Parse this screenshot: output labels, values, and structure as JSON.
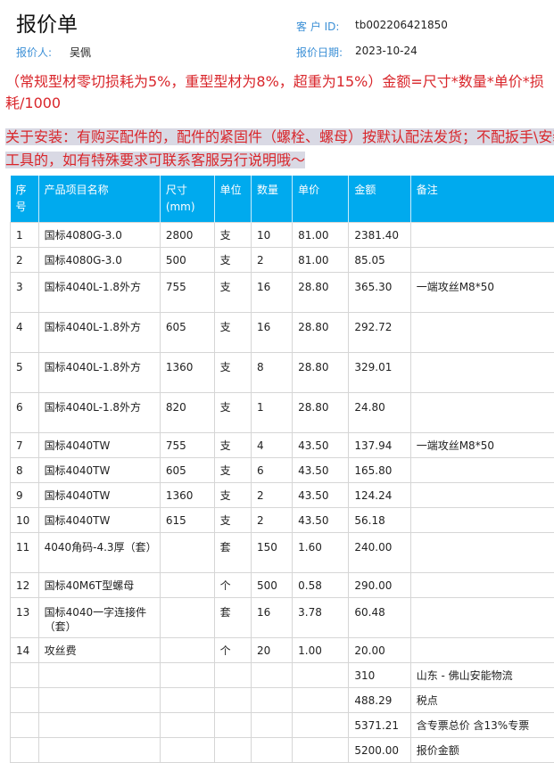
{
  "header": {
    "title": "报价单",
    "customer_id_label": "客 户 ID:",
    "customer_id": "tb002206421850",
    "quoter_label": "报价人:",
    "quoter": "吴佩",
    "date_label": "报价日期:",
    "date": "2023-10-24"
  },
  "notes": {
    "formula": "（常规型材零切损耗为5%，重型型材为8%，超重为15%）金额=尺寸*数量*单价*损耗/1000",
    "install": "关于安装：有购买配件的，配件的紧固件（螺栓、螺母）按默认配法发货；不配扳手\\安装工具的，如有特殊要求可联系客服另行说明哦～"
  },
  "table": {
    "headers": [
      "序号",
      "产品项目名称",
      "尺寸(mm)",
      "单位",
      "数量",
      "单价",
      "金额",
      "备注"
    ],
    "rows": [
      [
        "1",
        "国标4080G-3.0",
        "2800",
        "支",
        "10",
        "81.00",
        "2381.40",
        ""
      ],
      [
        "2",
        "国标4080G-3.0",
        "500",
        "支",
        "2",
        "81.00",
        "85.05",
        ""
      ],
      [
        "3",
        "国标4040L-1.8外方",
        "755",
        "支",
        "16",
        "28.80",
        "365.30",
        "一端攻丝M8*50"
      ],
      [
        "4",
        "国标4040L-1.8外方",
        "605",
        "支",
        "16",
        "28.80",
        "292.72",
        ""
      ],
      [
        "5",
        "国标4040L-1.8外方",
        "1360",
        "支",
        "8",
        "28.80",
        "329.01",
        ""
      ],
      [
        "6",
        "国标4040L-1.8外方",
        "820",
        "支",
        "1",
        "28.80",
        "24.80",
        ""
      ],
      [
        "7",
        "国标4040TW",
        "755",
        "支",
        "4",
        "43.50",
        "137.94",
        "一端攻丝M8*50"
      ],
      [
        "8",
        "国标4040TW",
        "605",
        "支",
        "6",
        "43.50",
        "165.80",
        ""
      ],
      [
        "9",
        "国标4040TW",
        "1360",
        "支",
        "2",
        "43.50",
        "124.24",
        ""
      ],
      [
        "10",
        "国标4040TW",
        "615",
        "支",
        "2",
        "43.50",
        "56.18",
        ""
      ],
      [
        "11",
        "4040角码-4.3厚（套）",
        "",
        "套",
        "150",
        "1.60",
        "240.00",
        ""
      ],
      [
        "12",
        "国标40M6T型螺母",
        "",
        "个",
        "500",
        "0.58",
        "290.00",
        ""
      ],
      [
        "13",
        "国标4040一字连接件（套）",
        "",
        "套",
        "16",
        "3.78",
        "60.48",
        ""
      ],
      [
        "14",
        "攻丝费",
        "",
        "个",
        "20",
        "1.00",
        "20.00",
        ""
      ]
    ],
    "summary": [
      {
        "amount": "310",
        "note": "山东 - 佛山安能物流"
      },
      {
        "amount": "488.29",
        "note": "税点"
      },
      {
        "amount": "5371.21",
        "note": "含专票总价 含13%专票"
      },
      {
        "amount": "5200.00",
        "note": "报价金额"
      }
    ]
  }
}
